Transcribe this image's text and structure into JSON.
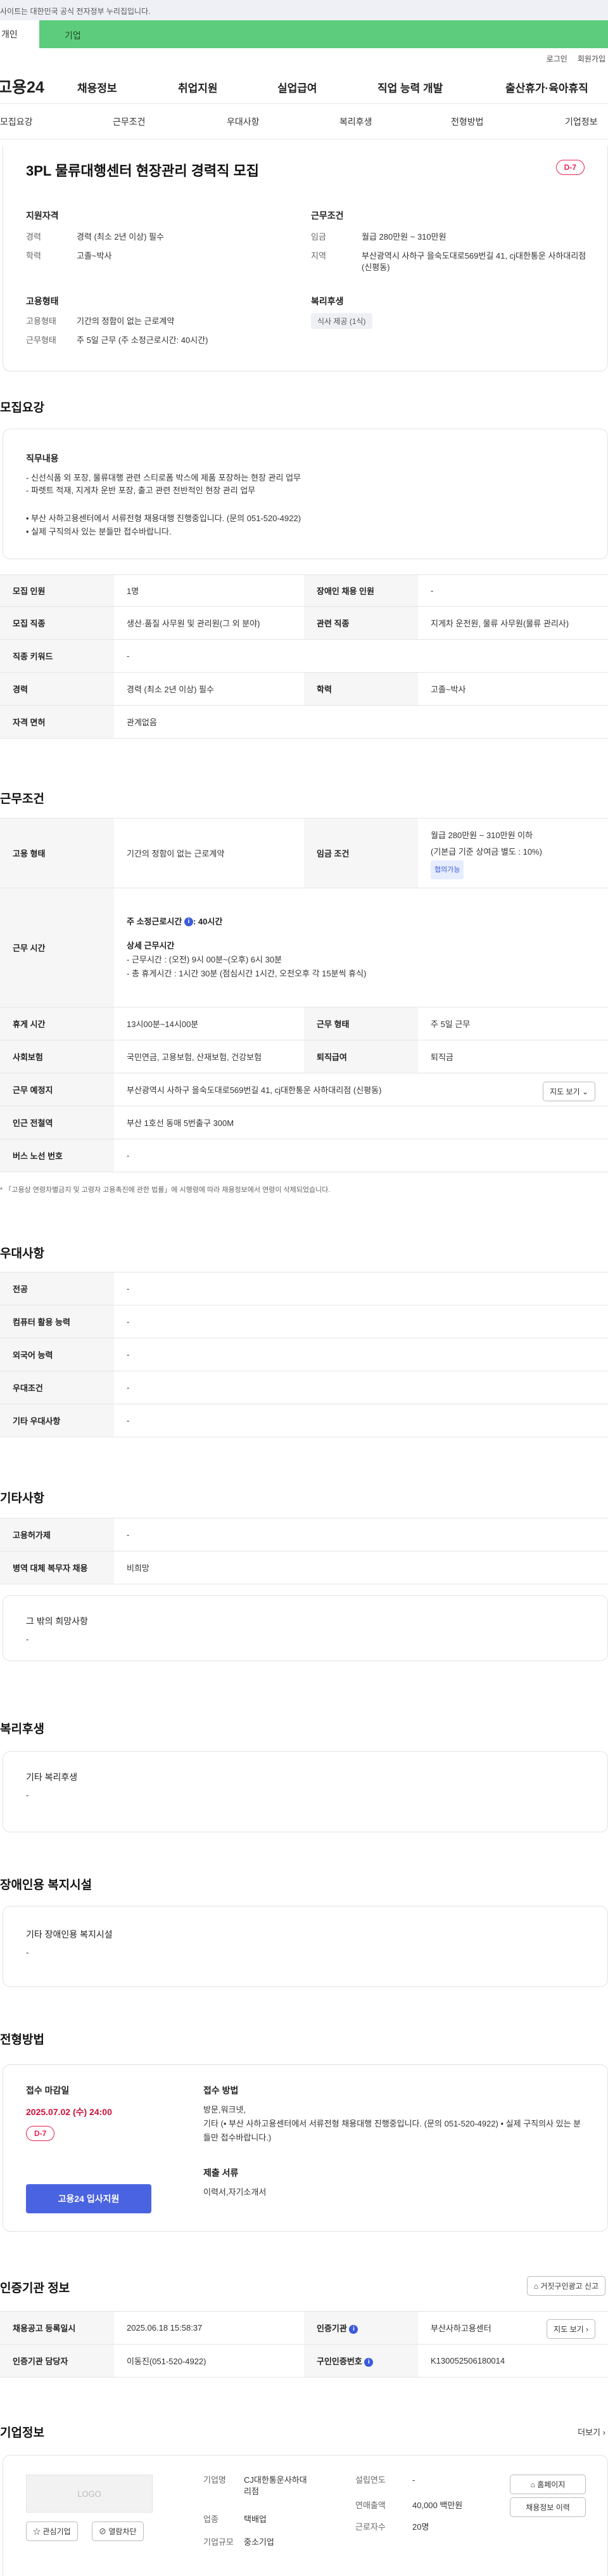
{
  "gov_notice": "사이트는 대한민국 공식 전자정부 누리집입니다.",
  "tabs": {
    "personal": "개인",
    "business": "기업"
  },
  "util": {
    "login": "로그인",
    "join": "회원가입"
  },
  "logo": "고용24",
  "gnb": [
    "채용정보",
    "취업지원",
    "실업급여",
    "직업 능력 개발",
    "출산휴가·육아휴직"
  ],
  "anchors": [
    "모집요강",
    "근무조건",
    "우대사항",
    "복리후생",
    "전형방법",
    "기업정보"
  ],
  "job": {
    "title": "3PL 물류대행센터 현장관리 경력직 모집",
    "dday": "D-7",
    "qualification": {
      "heading": "지원자격",
      "career_k": "경력",
      "career_v": "경력 (최소 2년 이상) 필수",
      "edu_k": "학력",
      "edu_v": "고졸~박사"
    },
    "conditions": {
      "heading": "근무조건",
      "wage_k": "임금",
      "wage_v": "월급 280만원 ~ 310만원",
      "region_k": "지역",
      "region_v": "부산광역시 사하구 을숙도대로569번길 41, cj대한통운 사하대리점 (신평동)"
    },
    "employment": {
      "heading": "고용형태",
      "type_k": "고용형태",
      "type_v": "기간의 정함이 없는 근로계약",
      "work_k": "근무형태",
      "work_v": "주 5일 근무 (주 소정근로시간: 40시간)"
    },
    "welfare": {
      "heading": "복리후생",
      "tag": "식사 제공 (1식)"
    }
  },
  "recruit": {
    "section": "모집요강",
    "duty_heading": "직무내용",
    "duty_lines": [
      "- 신선식품 외 포장, 물류대행 관련 스티로폼 박스에 제품 포장하는 현장 관리 업무",
      "- 파렛트 적재, 지게차 운반 포장, 출고 관련 전반적인 현장 관리 업무"
    ],
    "notes": [
      "• 부산 사하고용센터에서 서류전형 채용대행 진행중입니다. (문의 051-520-4922)",
      "• 실제 구직의사 있는 분들만 접수바랍니다."
    ],
    "rows": {
      "headcount_k": "모집 인원",
      "headcount_v": "1명",
      "disabled_k": "장애인 채용 인원",
      "disabled_v": "-",
      "job_k": "모집 직종",
      "job_v": "생산·품질 사무원 및 관리원(그 외 분야)",
      "related_k": "관련 직종",
      "related_v": "지게차 운전원, 물류 사무원(물류 관리사)",
      "keyword_k": "직종 키워드",
      "keyword_v": "-",
      "career_k": "경력",
      "career_v": "경력 (최소 2년 이상) 필수",
      "edu_k": "학력",
      "edu_v": "고졸~박사",
      "license_k": "자격 면허",
      "license_v": "관계없음"
    }
  },
  "work": {
    "section": "근무조건",
    "type_k": "고용 형태",
    "type_v": "기간의 정함이 없는 근로계약",
    "wage_k": "임금 조건",
    "wage_v1": "월급 280만원 ~ 310만원 이하",
    "wage_v2": "(기본급 기준 상여금 별도 : 10%)",
    "wage_chip": "협의가능",
    "time_k": "근무 시간",
    "time_main_label": "주 소정근로시간",
    "time_main_value": ": 40시간",
    "time_detail_heading": "상세 근무시간",
    "time_detail_1": "- 근무시간 : (오전) 9시 00분~(오후) 6시 30분",
    "time_detail_2": "- 총 휴게시간 : 1시간 30분 (점심시간 1시간, 오전오후 각 15분씩 휴식)",
    "break_k": "휴게 시간",
    "break_v": "13시00분~14시00분",
    "form_k": "근무 형태",
    "form_v": "주 5일 근무",
    "insurance_k": "사회보험",
    "insurance_v": "국민연금, 고용보험, 산재보험, 건강보험",
    "severance_k": "퇴직급여",
    "severance_v": "퇴직금",
    "location_k": "근무 예정지",
    "location_v": "부산광역시 사하구 을숙도대로569번길 41, cj대한통운 사하대리점 (신평동)",
    "map_btn": "지도 보기",
    "station_k": "인근 전철역",
    "station_v": "부산 1호선 동매 5번출구 300M",
    "bus_k": "버스 노선 번호",
    "bus_v": "-",
    "footnote": "* 「고용상 연령차별금지 및 고령자 고용촉진에 관한 법률」에 시행령에 따라 채용정보에서 연령이 삭제되었습니다."
  },
  "pref": {
    "section": "우대사항",
    "rows": [
      {
        "k": "전공",
        "v": "-"
      },
      {
        "k": "컴퓨터 활용 능력",
        "v": "-"
      },
      {
        "k": "외국어 능력",
        "v": "-"
      },
      {
        "k": "우대조건",
        "v": "-"
      },
      {
        "k": "기타 우대사항",
        "v": "-"
      }
    ]
  },
  "etc": {
    "section": "기타사항",
    "rows": [
      {
        "k": "고용허가제",
        "v": "-"
      },
      {
        "k": "병역 대체 복무자 채용",
        "v": "비희망"
      }
    ],
    "other_heading": "그 밖의 희망사항",
    "other_value": "-"
  },
  "benefit": {
    "section": "복리후생",
    "heading": "기타 복리후생",
    "value": "-"
  },
  "facility": {
    "section": "장애인용 복지시설",
    "heading": "기타 장애인용 복지시설",
    "value": "-"
  },
  "process": {
    "section": "전형방법",
    "deadline_heading": "접수 마감일",
    "deadline": "2025.07.02 (수) 24:00",
    "dday": "D-7",
    "method_heading": "접수 방법",
    "method_1": "방문,워크넷,",
    "method_2": "기타 (• 부산 사하고용센터에서 서류전형 채용대행 진행중입니다. (문의 051-520-4922) • 실제 구직의사 있는 분들만 접수바랍니다.)",
    "docs_heading": "제출 서류",
    "docs": "이력서,자기소개서",
    "apply_btn": "고용24 입사지원"
  },
  "cert": {
    "section": "인증기관 정보",
    "report_btn": "거짓구인광고 신고",
    "reg_k": "채용공고 등록일시",
    "reg_v": "2025.06.18 15:58:37",
    "agency_k": "인증기관",
    "agency_v": "부산사하고용센터",
    "map_btn": "지도 보기",
    "staff_k": "인증기관 담당자",
    "staff_v": "이동진(051-520-4922)",
    "no_k": "구인인증번호",
    "no_v": "K130052506180014"
  },
  "company": {
    "section": "기업정보",
    "more": "더보기",
    "logo": "LOGO",
    "fav_btn": "관심기업",
    "block_btn": "열람차단",
    "name_k": "기업명",
    "name_v": "CJ대한통운사하대리점",
    "industry_k": "업종",
    "industry_v": "택배업",
    "scale_k": "기업규모",
    "scale_v": "중소기업",
    "founded_k": "설립연도",
    "founded_v": "-",
    "sales_k": "연매출액",
    "sales_v": "40,000 백만원",
    "staff_k": "근로자수",
    "staff_v": "20명",
    "homepage_btn": "홈페이지",
    "jobs_btn": "채용정보 이력"
  }
}
